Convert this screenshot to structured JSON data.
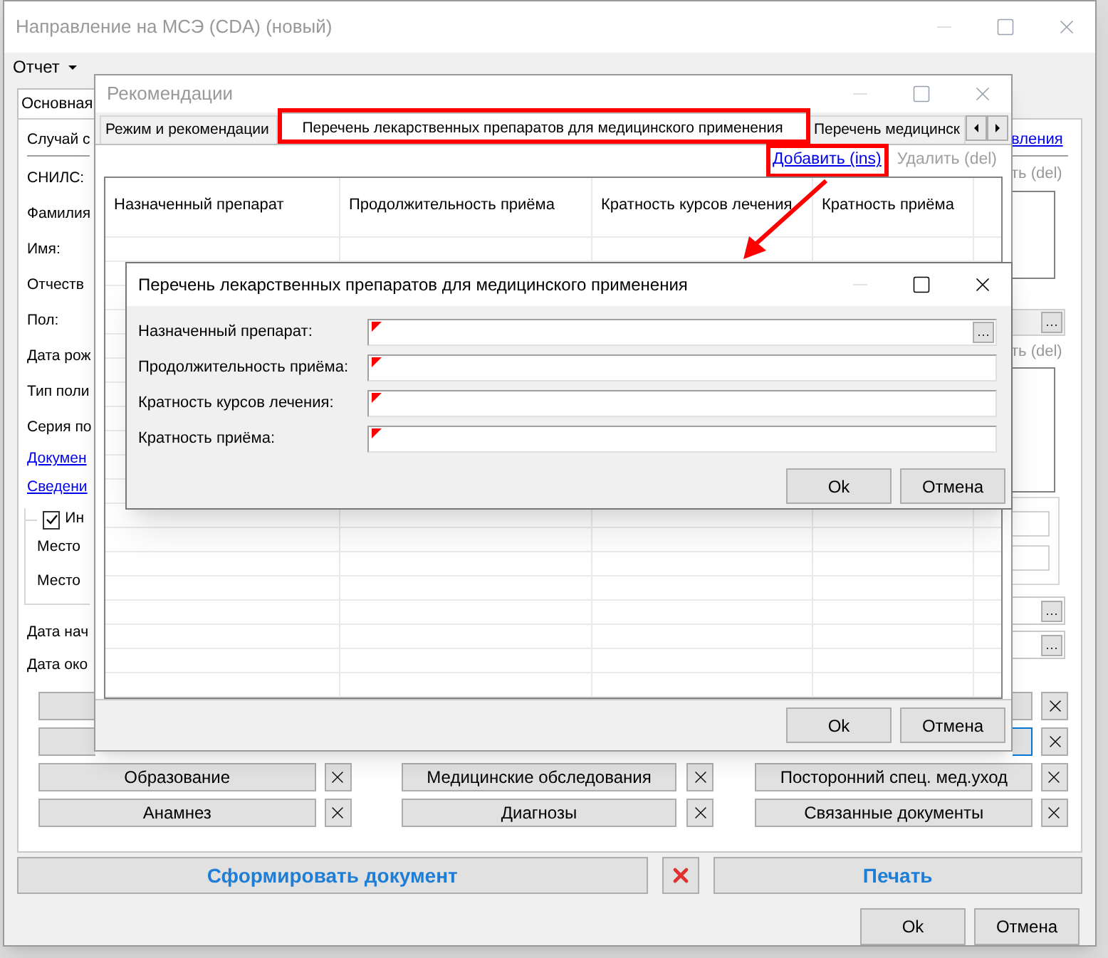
{
  "main_window": {
    "title": "Направление на МСЭ (CDA) (новый)",
    "menu": [
      {
        "label": "Отчет"
      }
    ],
    "tabs": [
      {
        "label": "Основная",
        "selected": true
      }
    ],
    "form_rows": [
      {
        "kind": "heading",
        "text": "Случай с"
      },
      {
        "kind": "label",
        "text": "СНИЛС:"
      },
      {
        "kind": "label",
        "text": "Фамилия"
      },
      {
        "kind": "label",
        "text": "Имя:"
      },
      {
        "kind": "label",
        "text": "Отчеств"
      },
      {
        "kind": "label",
        "text": "Пол:"
      },
      {
        "kind": "label",
        "text": "Дата рож"
      },
      {
        "kind": "label",
        "text": "Тип поли"
      },
      {
        "kind": "label",
        "text": "Серия по"
      },
      {
        "kind": "link",
        "text": "Докумен"
      },
      {
        "kind": "link",
        "text": "Сведени"
      }
    ],
    "group": {
      "checkbox": {
        "label": "Ин",
        "checked": true
      },
      "labels": [
        "Место",
        "Место"
      ]
    },
    "date_labels": [
      "Дата нач",
      "Дата око"
    ],
    "right_strip": {
      "link": "вления",
      "delete_links": [
        "ть (del)",
        "ть (del)"
      ]
    },
    "section_buttons": [
      {
        "label": "Образование"
      },
      {
        "label": "Медицинские обследования"
      },
      {
        "label": "Посторонний спец. мед.уход"
      },
      {
        "label": "Анамнез"
      },
      {
        "label": "Диагнозы"
      },
      {
        "label": "Связанные документы"
      }
    ],
    "generate_button": "Сформировать документ",
    "print_button": "Печать",
    "buttons": [
      "Ok",
      "Отмена"
    ]
  },
  "recommendations_window": {
    "title": "Рекомендации",
    "tabs": [
      {
        "label": "Режим и рекомендации",
        "selected": false
      },
      {
        "label": "Перечень лекарственных препаратов для медицинского применения",
        "selected": true
      },
      {
        "label": "Перечень медицинск",
        "selected": false
      }
    ],
    "actions": [
      {
        "label": "Добавить (ins)",
        "disabled": false
      },
      {
        "label": "Удалить (del)",
        "disabled": true
      }
    ],
    "table": {
      "columns": [
        "Назначенный препарат",
        "Продолжительность приёма",
        "Кратность курсов лечения",
        "Кратность  приёма"
      ]
    },
    "buttons": [
      "Ok",
      "Отмена"
    ]
  },
  "dialog": {
    "title": "Перечень лекарственных препаратов для медицинского применения",
    "fields": [
      {
        "label": "Назначенный препарат:",
        "required": true,
        "lookup": true
      },
      {
        "label": "Продолжительность приёма:",
        "required": true,
        "lookup": false
      },
      {
        "label": "Кратность курсов лечения:",
        "required": true,
        "lookup": false
      },
      {
        "label": "Кратность  приёма:",
        "required": true,
        "lookup": false
      }
    ],
    "buttons": [
      "Ok",
      "Отмена"
    ]
  }
}
